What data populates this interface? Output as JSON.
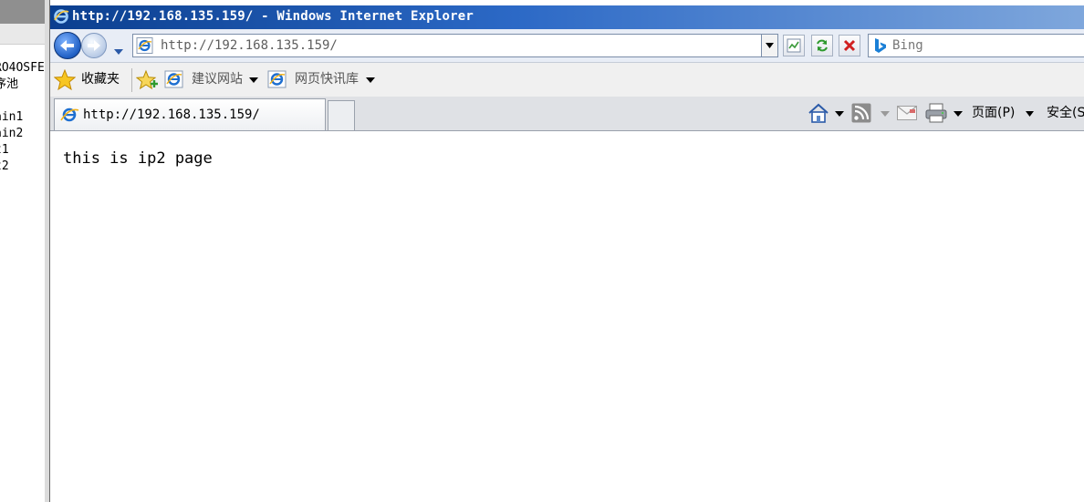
{
  "background_window": {
    "tree_lines": [
      "RO4OSFE",
      "序池",
      "",
      "ain1",
      "ain2",
      "t1",
      "t2"
    ]
  },
  "window": {
    "title": "http://192.168.135.159/ - Windows Internet Explorer"
  },
  "address_bar": {
    "url": "http://192.168.135.159/",
    "search_placeholder": "Bing"
  },
  "favorites_bar": {
    "favorites_label": "收藏夹",
    "suggested_sites_label": "建议网站",
    "web_slice_gallery_label": "网页快讯库"
  },
  "tabs": [
    {
      "label": "http://192.168.135.159/"
    }
  ],
  "command_bar": {
    "page_label": "页面(P)",
    "safety_label": "安全(S"
  },
  "page": {
    "text": "this is ip2 page"
  },
  "colors": {
    "title_bar_start": "#0b3f8f",
    "title_bar_end": "#7fa7dc",
    "stop_red": "#d02020",
    "refresh_green": "#2e9a2e"
  }
}
